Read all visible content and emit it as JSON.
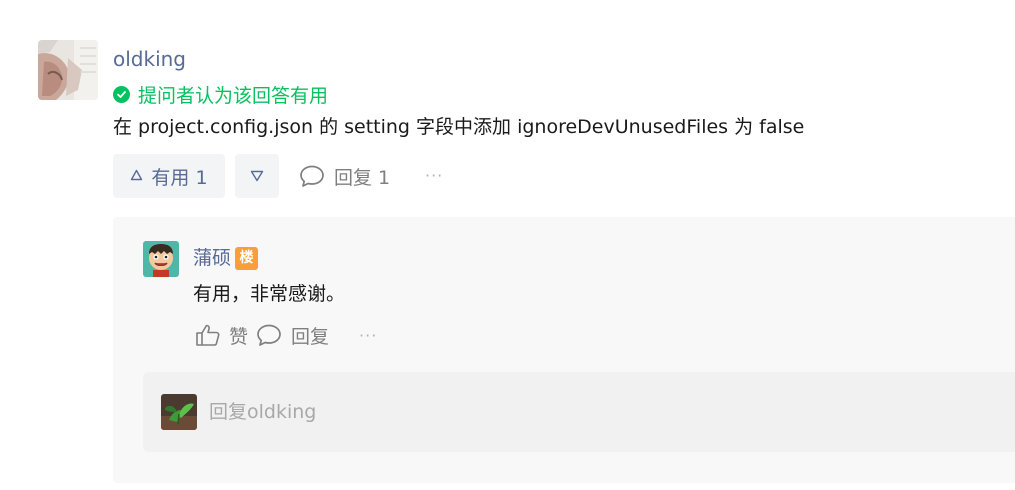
{
  "answer": {
    "author": "oldking",
    "accepted_text": "提问者认为该回答有用",
    "content": "在 project.config.json 的 setting 字段中添加 ignoreDevUnusedFiles 为 false",
    "useful_label": "有用 1",
    "reply_label": "回复 1",
    "more_label": "···",
    "up_icon": "triangle-up-outline-icon",
    "down_icon": "triangle-down-outline-icon",
    "reply_icon": "speech-bubble-icon",
    "accepted_icon": "check-circle-icon"
  },
  "comment": {
    "author": "蒲硕",
    "floor_badge": "楼",
    "text": "有用，非常感谢。",
    "like_label": "赞",
    "reply_label": "回复",
    "more_label": "···",
    "like_icon": "thumbs-up-icon",
    "reply_icon": "speech-bubble-icon"
  },
  "reply_box": {
    "placeholder": "回复oldking"
  },
  "colors": {
    "link": "#576b95",
    "accepted": "#07c160",
    "badge": "#fa9d3b",
    "muted": "#7f7f7f",
    "panel": "#f8f8f8",
    "input": "#f1f1f1"
  }
}
